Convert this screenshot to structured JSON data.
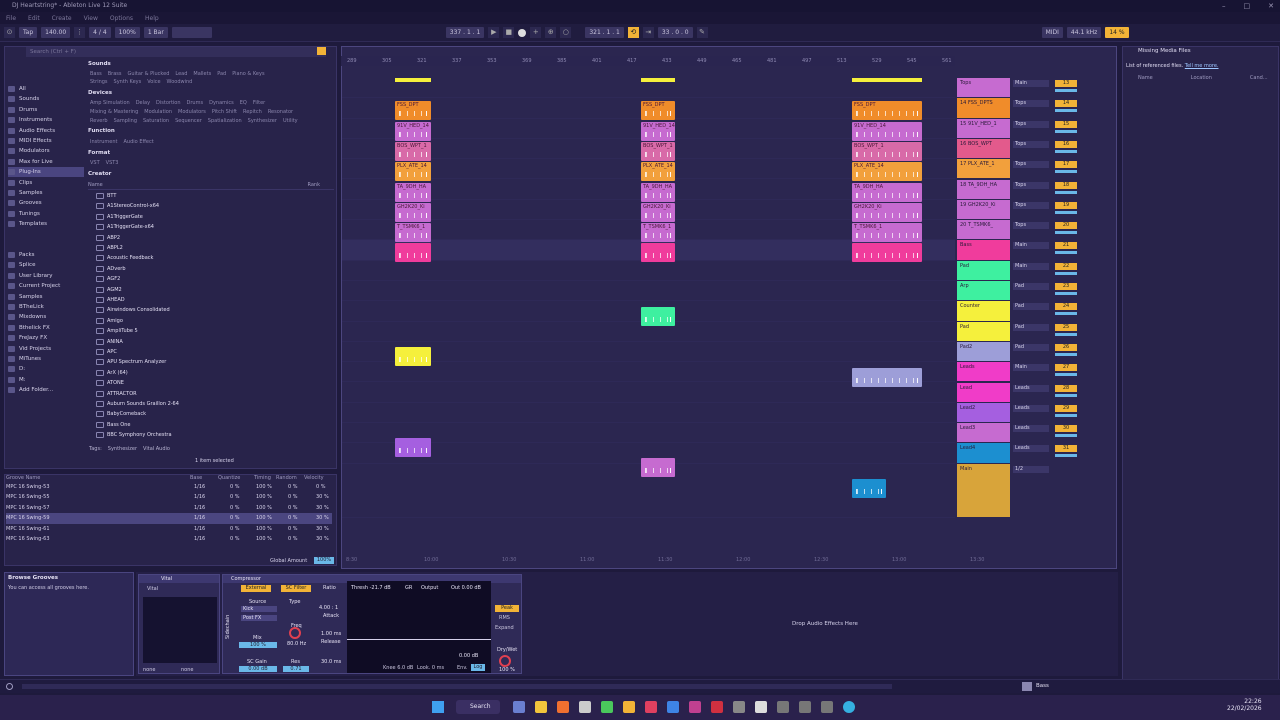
{
  "window": {
    "title": "DJ Heartstring* - Ableton Live 12 Suite",
    "min": "–",
    "max": "□",
    "close": "✕"
  },
  "menu": [
    "File",
    "Edit",
    "Create",
    "View",
    "Options",
    "Help"
  ],
  "transport": {
    "tap": "Tap",
    "tempo": "140.00",
    "sig": "4 / 4",
    "zoom": "100%",
    "quant": "1 Bar",
    "pos": "337 .  1 .  1",
    "pos2": "321 .  1 .  1",
    "len": "33 .  0 .  0",
    "cpu": "14 %",
    "midi": "MIDI",
    "sr": "44.1 kHz"
  },
  "browser": {
    "search_placeholder": "Search (Ctrl + F)",
    "sidebar": [
      "All",
      "Sounds",
      "Drums",
      "Instruments",
      "Audio Effects",
      "MIDI Effects",
      "Modulators",
      "Max for Live",
      "Plug-Ins",
      "Clips",
      "Samples",
      "Grooves",
      "Tunings",
      "Templates"
    ],
    "places": [
      "Packs",
      "Splice",
      "User Library",
      "Current Project",
      "Samples",
      "BTheLick",
      "Mixdowns",
      "Bthelick FX",
      "FreJazy FX",
      "Vid Projects",
      "MiTunes",
      "D:",
      "M:",
      "Add Folder..."
    ],
    "filters": {
      "sounds_h": "Sounds",
      "sounds": [
        "Bass",
        "Brass",
        "Guitar & Plucked",
        "Lead",
        "Mallets",
        "Pad",
        "Piano & Keys"
      ],
      "sounds2": [
        "Strings",
        "Synth Keys",
        "Voice",
        "Woodwind"
      ],
      "devices_h": "Devices",
      "devices": [
        "Amp Simulation",
        "Delay",
        "Distortion",
        "Drums",
        "Dynamics",
        "EQ",
        "Filter"
      ],
      "devices2": [
        "Mixing & Mastering",
        "Modulation",
        "Modulators",
        "Pitch Shift",
        "Repitch",
        "Resonator"
      ],
      "devices3": [
        "Reverb",
        "Sampling",
        "Saturation",
        "Sequencer",
        "Spatialization",
        "Synthesizer",
        "Utility"
      ],
      "function_h": "Function",
      "function": [
        "Instrument",
        "Audio Effect"
      ],
      "format_h": "Format",
      "format": [
        "VST",
        "VST3"
      ],
      "creator_h": "Creator"
    },
    "name_h": "Name",
    "rank_h": "Rank",
    "plugins": [
      "BTT",
      "A1StereoControl-x64",
      "A1TriggerGate",
      "A1TriggerGate-x64",
      "ABP2",
      "ABPL2",
      "Acoustic Feedback",
      "ADverb",
      "AGF2",
      "AGM2",
      "AHEAD",
      "Airwindows Consolidated",
      "Amigo",
      "AmpliTube 5",
      "ANINA",
      "APC",
      "APU Spectrum Analyzer",
      "ArX (64)",
      "ATONE",
      "ATTRACTOR",
      "Auburn Sounds Graillon 2-64",
      "BabyComeback",
      "Bass One",
      "BBC Symphony Orchestra"
    ],
    "tags": "Tags:",
    "tag1": "Synthesizer",
    "tag2": "Vital Audio",
    "selected": "1 item selected"
  },
  "groove": {
    "headers": [
      "Groove Name",
      "Base",
      "Quantize",
      "Timing",
      "Random",
      "Velocity"
    ],
    "rows": [
      {
        "name": "MPC 16 Swing-53",
        "base": "1/16",
        "q": "0 %",
        "t": "100 %",
        "r": "0 %",
        "v": "0 %"
      },
      {
        "name": "MPC 16 Swing-55",
        "base": "1/16",
        "q": "0 %",
        "t": "100 %",
        "r": "0 %",
        "v": "30 %"
      },
      {
        "name": "MPC 16 Swing-57",
        "base": "1/16",
        "q": "0 %",
        "t": "100 %",
        "r": "0 %",
        "v": "30 %"
      },
      {
        "name": "MPC 16 Swing-59",
        "base": "1/16",
        "q": "0 %",
        "t": "100 %",
        "r": "0 %",
        "v": "30 %"
      },
      {
        "name": "MPC 16 Swing-61",
        "base": "1/16",
        "q": "0 %",
        "t": "100 %",
        "r": "0 %",
        "v": "30 %"
      },
      {
        "name": "MPC 16 Swing-63",
        "base": "1/16",
        "q": "0 %",
        "t": "100 %",
        "r": "0 %",
        "v": "30 %"
      }
    ],
    "global": "Global Amount",
    "global_val": "100%"
  },
  "ruler": [
    "289",
    "305",
    "321",
    "337",
    "353",
    "369",
    "385",
    "401",
    "417",
    "433",
    "449",
    "465",
    "481",
    "497",
    "513",
    "529",
    "545",
    "561"
  ],
  "timeline": [
    "8:30",
    "10:00",
    "10:30",
    "11:00",
    "11:30",
    "12:00",
    "12:30",
    "13:00",
    "13:30"
  ],
  "tracks": [
    {
      "name": "Tops",
      "route": "Main",
      "num": "13",
      "color": "#c66bd0"
    },
    {
      "name": "14 FSS_DPTS",
      "route": "Tops",
      "num": "14",
      "color": "#f08c2a"
    },
    {
      "name": "15 91V_HED_1",
      "route": "Tops",
      "num": "15",
      "color": "#c66bd0"
    },
    {
      "name": "16 BOS_WPT",
      "route": "Tops",
      "num": "16",
      "color": "#e35a8c"
    },
    {
      "name": "17 PLX_ATE_1",
      "route": "Tops",
      "num": "17",
      "color": "#f2a03c"
    },
    {
      "name": "18 TA_9DH_HA",
      "route": "Tops",
      "num": "18",
      "color": "#c66bd0"
    },
    {
      "name": "19 GH2K20_Ki",
      "route": "Tops",
      "num": "19",
      "color": "#c66bd0"
    },
    {
      "name": "20 T_TSMK6_",
      "route": "Tops",
      "num": "20",
      "color": "#c66bd0"
    },
    {
      "name": "Bass",
      "route": "Main",
      "num": "21",
      "color": "#f03c9c"
    },
    {
      "name": "Pad",
      "route": "Main",
      "num": "22",
      "color": "#3ef0a0"
    },
    {
      "name": "Arp",
      "route": "Pad",
      "num": "23",
      "color": "#3ef0a0"
    },
    {
      "name": "Counter",
      "route": "Pad",
      "num": "24",
      "color": "#f5f03c"
    },
    {
      "name": "Pad",
      "route": "Pad",
      "num": "25",
      "color": "#f5f03c"
    },
    {
      "name": "Pad2",
      "route": "Pad",
      "num": "26",
      "color": "#9d9ed8"
    },
    {
      "name": "Leads",
      "route": "Main",
      "num": "27",
      "color": "#f03cc8"
    },
    {
      "name": "Lead",
      "route": "Leads",
      "num": "28",
      "color": "#f03cc8"
    },
    {
      "name": "Lead2",
      "route": "Leads",
      "num": "29",
      "color": "#a55fe0"
    },
    {
      "name": "Lead3",
      "route": "Leads",
      "num": "30",
      "color": "#c66bd0"
    },
    {
      "name": "Lead4",
      "route": "Leads",
      "num": "31",
      "color": "#1c8fd0"
    },
    {
      "name": "Main",
      "route": "1/2",
      "num": "",
      "color": "#d8a43a"
    }
  ],
  "clips": [
    {
      "t": 1,
      "c": "#f08c2a",
      "l": "FSS_DPT"
    },
    {
      "t": 2,
      "c": "#c66bd0",
      "l": "91V_HED_14"
    },
    {
      "t": 3,
      "c": "#d86aa8",
      "l": "BOS_WPT_1"
    },
    {
      "t": 4,
      "c": "#f2a03c",
      "l": "PLX_ATE_14"
    },
    {
      "t": 5,
      "c": "#c66bd0",
      "l": "TA_9DH_HA"
    },
    {
      "t": 6,
      "c": "#c66bd0",
      "l": "GH2K20_Ki"
    },
    {
      "t": 7,
      "c": "#c66bd0",
      "l": "T_TSMK6_1"
    },
    {
      "t": 8,
      "c": "#f03c9c",
      "l": ""
    }
  ],
  "right": {
    "title": "Missing Media Files",
    "desc": "List of referenced files.",
    "link": "Tell me more.",
    "col1": "Name",
    "col2": "Location",
    "col3": "Cand..."
  },
  "devices": {
    "browse_title": "Browse Grooves",
    "browse_desc": "You can access all grooves here.",
    "vital": "Vital",
    "vital_sub": "Vital",
    "none1": "none",
    "none2": "none",
    "comp": "Compressor",
    "external": "External",
    "sc_filter": "SC Filter",
    "ratio": "Ratio",
    "ratio_val": "4.00 : 1",
    "source": "Source",
    "src_val": "Kick",
    "post": "Post FX",
    "type": "Type",
    "attack": "Attack",
    "att_val": "1.00 ms",
    "release": "Release",
    "rel_val": "30.0 ms",
    "freq": "Freq",
    "freq_val": "80.0 Hz",
    "mix": "Mix",
    "mix_val": "100 %",
    "scgain": "SC Gain",
    "scgain_val": "0.00 dB",
    "res": "Res",
    "res_val": "0.71",
    "thresh": "Thresh -21.7 dB",
    "gr": "GR",
    "output": "Output",
    "out_val": "Out 0.00 dB",
    "db": "0.00 dB",
    "peak": "Peak",
    "rms": "RMS",
    "expand": "Expand",
    "knee": "Knee 6.0 dB",
    "look": "Look. 0 ms",
    "env": "Env.",
    "log": "Log",
    "drywet": "Dry/Wet",
    "dw_val": "100 %",
    "sidechain": "Sidechain",
    "drop": "Drop Audio Effects Here"
  },
  "status": {
    "track": "Bass"
  },
  "taskbar": {
    "search": "Search",
    "time": "22:26",
    "date": "22/02/2026"
  },
  "colors": {
    "accent": "#f2b337",
    "bg": "#1e1a3c"
  }
}
